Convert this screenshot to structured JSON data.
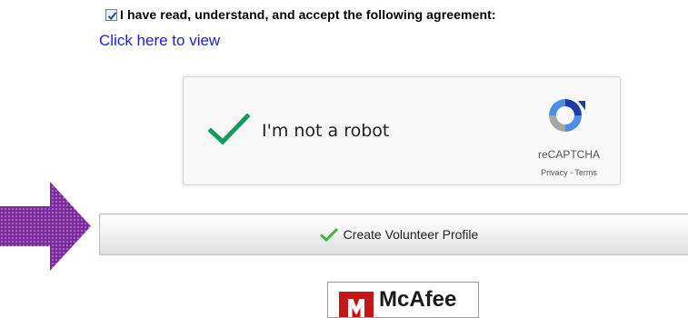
{
  "agreement": {
    "checkbox_checked": true,
    "text": "I have read, understand, and accept the following agreement:",
    "link_text": "Click here to view"
  },
  "recaptcha": {
    "label": "I'm not a robot",
    "brand": "reCAPTCHA",
    "privacy": "Privacy",
    "separator": " - ",
    "terms": "Terms",
    "check_color": "#0f9d58"
  },
  "create_button": {
    "label": "Create Volunteer Profile",
    "icon": "checkmark-icon",
    "icon_color": "#3cb83a"
  },
  "pointer_arrow": {
    "icon": "right-arrow-icon",
    "color": "#7a2a9c"
  },
  "badge": {
    "name": "McAfee",
    "color": "#c01818"
  }
}
